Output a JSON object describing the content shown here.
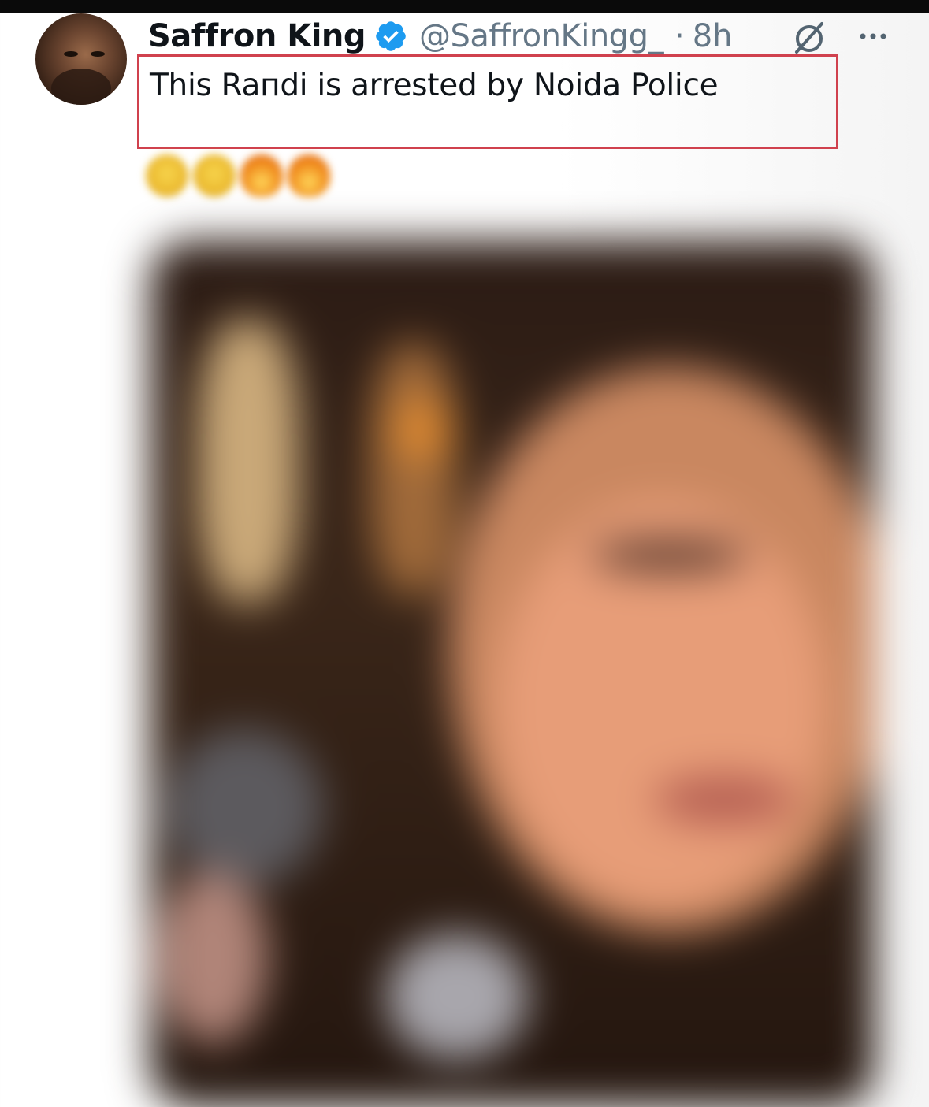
{
  "tweet": {
    "author_name": "Saffron King",
    "handle": "@SaffronKingg_",
    "separator": "·",
    "time": "8h",
    "text": "This Raпdi is arrested by Noida Police"
  },
  "icons": {
    "verified": "verified-badge-icon",
    "grok": "grok-icon",
    "more": "more-options-icon"
  },
  "colors": {
    "verified_blue": "#1d9bf0",
    "highlight_red": "#d0414e",
    "secondary_text": "#657786"
  },
  "media": {
    "state": "blurred"
  }
}
